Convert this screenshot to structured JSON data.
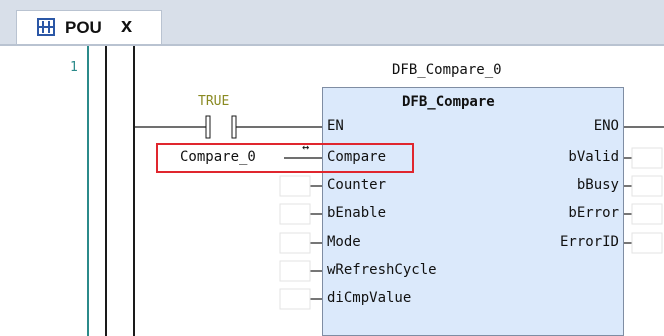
{
  "tab": {
    "label": "POU",
    "close_label": "x"
  },
  "editor": {
    "line_number": "1"
  },
  "rung": {
    "contact_label": "TRUE"
  },
  "function_block": {
    "instance_name": "DFB_Compare_0",
    "type_name": "DFB_Compare",
    "inputs": [
      "EN",
      "Compare",
      "Counter",
      "bEnable",
      "Mode",
      "wRefreshCycle",
      "diCmpValue"
    ],
    "outputs": [
      "ENO",
      "bValid",
      "bBusy",
      "bError",
      "ErrorID"
    ],
    "compare_input_value": "Compare_0"
  },
  "colors": {
    "block_fill": "#dbe9fb",
    "highlight": "#e0262e",
    "contact_label": "#8a8a22"
  }
}
